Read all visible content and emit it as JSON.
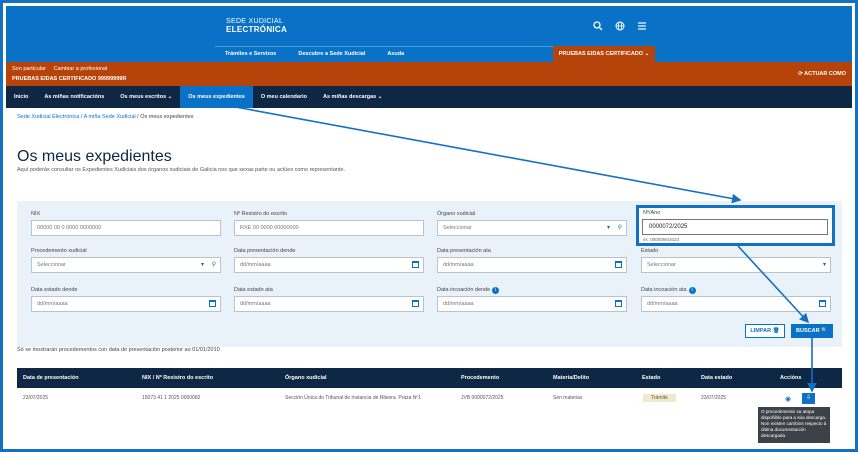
{
  "header": {
    "brand_line1": "SEDE XUDICIAL",
    "brand_line2": "ELECTRÓNICA",
    "menu": [
      "Trámites e Servizos",
      "Descubre a Sede Xudicial",
      "Axuda"
    ],
    "cert_button": "PRUEBAS EIDAS CERTIFICADO ⌄",
    "icons": [
      "search-icon",
      "globe-icon",
      "hamburger-icon"
    ]
  },
  "userbar": {
    "link1": "Son particular",
    "link2": "Cambiar a profesional",
    "cert_text": "PRUEBAS EIDAS CERTIFICADO 99999999R",
    "action": "⟳ ACTUAR COMO"
  },
  "nav": {
    "items": [
      "Inicio",
      "As miñas notificacións",
      "Os meus escritos ⌄",
      "Os meus expedientes",
      "O meu calendario",
      "As miñas descargas ⌄"
    ]
  },
  "breadcrumb": {
    "link": "Sede Xudicial Electrónica / A miña Sede Xudicial",
    "current": " / Os meus expedientes"
  },
  "page": {
    "title": "Os meus expedientes",
    "description": "Aquí poderás consultar os Expedientes Xudiciais dos órganos xudiciais de Galicia nos que sexas parte ou actúes como representante."
  },
  "filters": {
    "nix": {
      "label": "NIX",
      "placeholder": "00000 00 0 0000 0000000"
    },
    "registro": {
      "label": "Nº Rexistro do escrito",
      "placeholder": "RXE 00 0000 00000000"
    },
    "organo": {
      "label": "Órgano xudicial",
      "value": "Seleccionar"
    },
    "numero_ano": {
      "label": "Nº/Ano",
      "value": "0000072/2025",
      "hint": "ex. 0000066/2023"
    },
    "procedemento": {
      "label": "Procedemento xudicial",
      "value": "Seleccionar"
    },
    "pres_dende": {
      "label": "Data presentación dende",
      "placeholder": "dd/mm/aaaa"
    },
    "pres_ata": {
      "label": "Data presentación ata",
      "placeholder": "dd/mm/aaaa"
    },
    "estado": {
      "label": "Estado",
      "value": "Seleccionar"
    },
    "estado_dende": {
      "label": "Data estado dende",
      "placeholder": "dd/mm/aaaa"
    },
    "estado_ata": {
      "label": "Data estado ata",
      "placeholder": "dd/mm/aaaa"
    },
    "incoacion_dende": {
      "label": "Data incoación dende",
      "placeholder": "dd/mm/aaaa"
    },
    "incoacion_ata": {
      "label": "Data incoación ata",
      "placeholder": "dd/mm/aaaa"
    },
    "clear_label": "LIMPAR 🗑",
    "search_label": "BUSCAR 🔍"
  },
  "note": "Só se mostrarán procedementos con data de presentación posterior ao 01/01/2010",
  "table": {
    "headers": [
      "Data de presentación",
      "NIX / Nº Rexistro do escrito",
      "Órgano xudicial",
      "Procedemento",
      "Materia/Delito",
      "Estado",
      "Data estado",
      "Accións"
    ],
    "row": {
      "date": "23/07/2025",
      "nix": "15073 41 1 2025 0000082",
      "organo": "Sección Única do Tribunal de Instancia de Ribeira. Praza Nº1",
      "proc": "JVB 0000072/2025",
      "materia": "Sen materias",
      "estado": "Trámite",
      "data_estado": "23/07/2025"
    }
  },
  "tooltip": "O procedemento xa atopa dispoñible para a súa descarga. Non existen cambios respecto á última documentación descargada"
}
